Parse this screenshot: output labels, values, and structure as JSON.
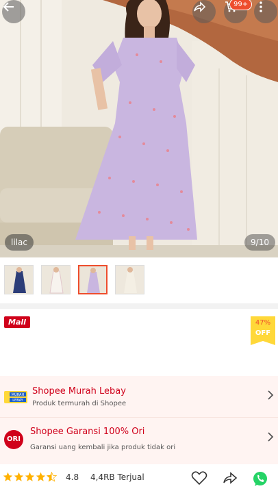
{
  "header": {
    "back_icon": "arrow-left-icon",
    "share_icon": "share-icon",
    "cart_icon": "cart-icon",
    "cart_badge": "99+",
    "more_icon": "more-vertical-icon"
  },
  "gallery": {
    "variant_label": "lilac",
    "counter": "9/10",
    "thumbnails": [
      "navy dress",
      "white dress",
      "lilac dress",
      "cream dress"
    ],
    "active_thumbnail": 2
  },
  "product": {
    "mall_badge": "Mall",
    "discount_pct": "47%",
    "discount_off": "OFF"
  },
  "promos": [
    {
      "badge_text": "MURAH LEBAY",
      "title": "Shopee Murah Lebay",
      "subtitle": "Produk termurah di Shopee"
    },
    {
      "badge_text": "ORI",
      "title": "Shopee Garansi 100% Ori",
      "subtitle": "Garansi uang kembali jika produk tidak ori"
    }
  ],
  "bottom": {
    "rating_value": "4.8",
    "sold": "4,4RB Terjual",
    "stars_filled": 4.5
  },
  "colors": {
    "accent": "#ee4d2d",
    "mall_red": "#d0011b",
    "discount_yellow": "#ffd839",
    "star": "#ffb100",
    "whatsapp": "#25d366"
  }
}
